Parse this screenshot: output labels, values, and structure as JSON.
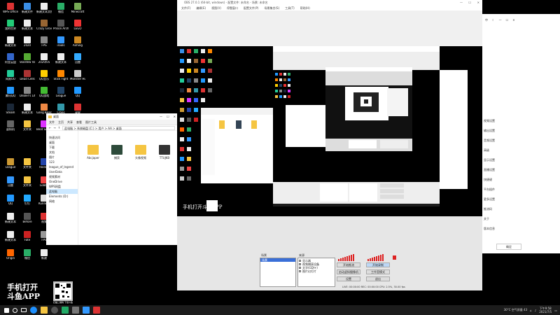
{
  "desktop": {
    "icons": [
      {
        "label": "WPS Office",
        "color": "#d33"
      },
      {
        "label": "新建文件",
        "color": "#3a8ee6"
      },
      {
        "label": "新建文本文档",
        "color": "#eee"
      },
      {
        "label": "微信",
        "color": "#2aae67"
      },
      {
        "label": "Minecraft",
        "color": "#7a5"
      },
      {
        "label": "我的世界",
        "color": "#2c7"
      },
      {
        "label": "新建文本",
        "color": "#eee"
      },
      {
        "label": "Crazy Grover",
        "color": "#963"
      },
      {
        "label": "Prison Architect",
        "color": "#555"
      },
      {
        "label": "LEGO",
        "color": "#e33"
      },
      {
        "label": "新建文本",
        "color": "#eee"
      },
      {
        "label": "2020",
        "color": "#eee"
      },
      {
        "label": "FPS",
        "color": "#888"
      },
      {
        "label": "iTools",
        "color": "#39f"
      },
      {
        "label": "Aiming",
        "color": "#c82"
      },
      {
        "label": "阿里云盘",
        "color": "#36c"
      },
      {
        "label": "Stardew Valley",
        "color": "#5a3"
      },
      {
        "label": "2020/05",
        "color": "#eee"
      },
      {
        "label": "新建文本",
        "color": "#eee"
      },
      {
        "label": "迅雷",
        "color": "#3af"
      },
      {
        "label": "网易UU",
        "color": "#2c9"
      },
      {
        "label": "Dead Cells",
        "color": "#a33"
      },
      {
        "label": "QQ音乐",
        "color": "#ffcf00"
      },
      {
        "label": "Stick Fight",
        "color": "#f80"
      },
      {
        "label": "Monster Hunter",
        "color": "#ccc"
      },
      {
        "label": "腾讯QQ",
        "color": "#29f"
      },
      {
        "label": "Dealer's Life",
        "color": "#888"
      },
      {
        "label": "QQ游戏",
        "color": "#4b3"
      },
      {
        "label": "League",
        "color": "#246"
      },
      {
        "label": "QQ",
        "color": "#29f"
      },
      {
        "label": "Steam",
        "color": "#1b2838"
      },
      {
        "label": "新建文本",
        "color": "#eee"
      },
      {
        "label": "Gang Beasts",
        "color": "#e84"
      },
      {
        "label": "Cities",
        "color": "#39a"
      },
      {
        "label": "录屏",
        "color": "#d33"
      },
      {
        "label": "虚拟机",
        "color": "#666"
      },
      {
        "label": "文件夹",
        "color": "#f5c542"
      },
      {
        "label": "Beat Saber",
        "color": "#d3f"
      },
      {
        "label": "百度",
        "color": "#36f"
      },
      {
        "label": "新建",
        "color": "#eee"
      }
    ],
    "icons2": [
      {
        "label": "League",
        "color": "#c93"
      },
      {
        "label": "文件夹",
        "color": "#f5c542"
      },
      {
        "label": "Rocket",
        "color": "#24a"
      },
      {
        "label": "迅雷",
        "color": "#39f"
      },
      {
        "label": "文件夹",
        "color": "#f5c542"
      },
      {
        "label": "Lobby",
        "color": "#e44"
      },
      {
        "label": "QQ",
        "color": "#29f"
      },
      {
        "label": "钉钉",
        "color": "#2af"
      },
      {
        "label": "Running",
        "color": "#ddd"
      },
      {
        "label": "新建文本",
        "color": "#eee"
      },
      {
        "label": "Before",
        "color": "#555"
      },
      {
        "label": "视频",
        "color": "#d33"
      },
      {
        "label": "新建文本",
        "color": "#eee"
      },
      {
        "label": "Fate",
        "color": "#c22"
      },
      {
        "label": "FPS",
        "color": "#999"
      },
      {
        "label": "Origin",
        "color": "#f60"
      },
      {
        "label": "微信",
        "color": "#2aae67"
      },
      {
        "label": "新建",
        "color": "#eee"
      }
    ]
  },
  "explorer": {
    "title": "桌面",
    "ribbon_tabs": [
      "文件",
      "主页",
      "共享",
      "查看",
      "图片工具"
    ],
    "path": "此电脑 > 系统磁盘 (C:) > 用户 > AA > 桌面",
    "nav_items": [
      "快速访问",
      "桌面",
      "下载",
      "文档",
      "图片",
      "123",
      "league_of_legend",
      "UserData",
      "视频素材",
      "OneDrive",
      "WPS网盘",
      "此电脑",
      "Elements (D:)",
      "网络"
    ],
    "selected_nav": 11,
    "files": [
      {
        "name": "Abcjaper",
        "kind": "folder"
      },
      {
        "name": "捕获",
        "kind": "image"
      },
      {
        "name": "头像视频",
        "kind": "folder"
      },
      {
        "name": "TTUJKB",
        "kind": "video"
      }
    ]
  },
  "obs": {
    "title": "OBS 27.0.1 (64-bit, windows) - 配置文件: 未命名 - 场景: 未命名",
    "menu": [
      "文件(F)",
      "编辑(E)",
      "视图(V)",
      "停靠窗口",
      "配置文件(P)",
      "场景集合(S)",
      "工具(T)",
      "帮助(H)"
    ],
    "scenes_label": "场景",
    "scene_item": "场景",
    "sources_label": "来源",
    "sources": [
      "显示器",
      "视频捕获设备",
      "文字(GDI+)",
      "图片幻灯片"
    ],
    "buttons": [
      "开始推流",
      "开始录制",
      "启动虚拟摄像机",
      "工作室模式",
      "设置",
      "退出"
    ],
    "status": "LIVE: 00:00:00   REC: 00:00:00   CPU: 2.5%, 30.00 fps"
  },
  "right_panel": {
    "items": [
      "视频设置",
      "输出设置",
      "音频设置",
      "高级",
      "显示设置",
      "直播设置",
      "快捷键",
      "平台插件",
      "更多设置",
      "推流码",
      "关于",
      "版本信息"
    ],
    "footer": "确定"
  },
  "watermark": {
    "line1": "手机打开",
    "line2": "斗鱼APP",
    "qr_caption": "扫描二维码 下载斗鱼"
  },
  "taskbar": {
    "temp": "30°C 空气质量 43",
    "time": "下午9:58",
    "date": "2021/7/5"
  }
}
